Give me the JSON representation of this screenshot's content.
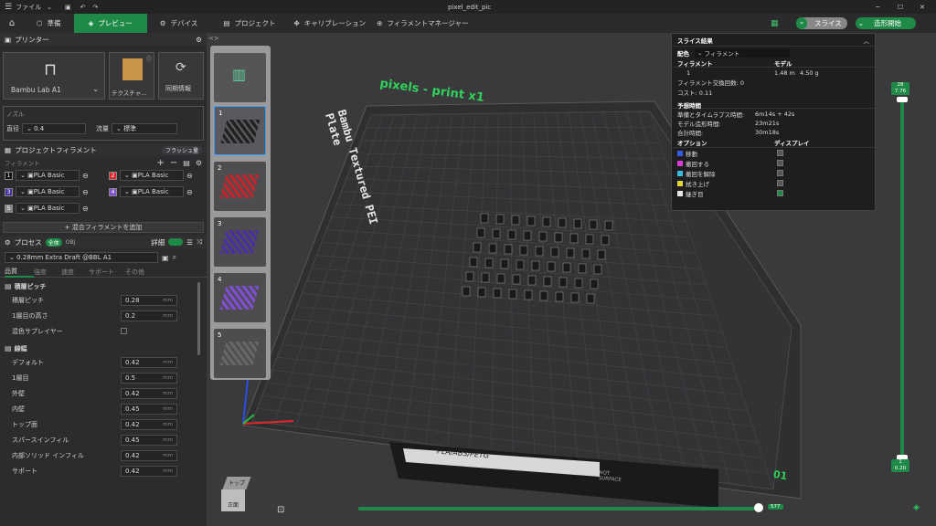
{
  "titlebar": {
    "menu": "ファイル",
    "title": "pixel_edit_pic"
  },
  "tabs": [
    {
      "label": "準備"
    },
    {
      "label": "プレビュー"
    },
    {
      "label": "デバイス"
    },
    {
      "label": "プロジェクト"
    },
    {
      "label": "キャリブレーション"
    },
    {
      "label": "フィラメントマネージャー"
    }
  ],
  "actions": {
    "slice": "スライス",
    "print": "造形開始"
  },
  "printer": {
    "header": "プリンター",
    "name": "Bambu Lab A1",
    "plate": "テクスチャ...",
    "sync": "同期情報",
    "nozzle_label": "ノズル",
    "diameter_label": "直径",
    "diameter": "0.4",
    "flow_label": "流量",
    "flow": "標準"
  },
  "filament": {
    "header": "プロジェクトフィラメント",
    "flush": "フラッシュ量",
    "sub": "フィラメント",
    "slots": [
      {
        "num": "1",
        "name": "PLA Basic",
        "color": "#111111"
      },
      {
        "num": "2",
        "name": "PLA Basic",
        "color": "#d8262b"
      },
      {
        "num": "3",
        "name": "PLA Basic",
        "color": "#4a2fa0"
      },
      {
        "num": "4",
        "name": "PLA Basic",
        "color": "#7d4fcf"
      },
      {
        "num": "5",
        "name": "PLA Basic",
        "color": "#888888"
      }
    ],
    "add": "混合フィラメントを追加"
  },
  "process": {
    "header": "プロセス",
    "all": "全体",
    "obj": "OBJ",
    "detail": "詳細",
    "profile": "0.28mm Extra Draft @BBL A1",
    "tabs": [
      "品質",
      "強度",
      "速度",
      "サポート",
      "その他"
    ],
    "layer_group": "積層ピッチ",
    "layer_rows": [
      {
        "label": "積層ピッチ",
        "value": "0.28",
        "unit": "mm"
      },
      {
        "label": "1層目の高さ",
        "value": "0.2",
        "unit": "mm"
      }
    ],
    "adaptive": "混色サプレイヤー",
    "width_group": "線幅",
    "width_rows": [
      {
        "label": "デフォルト",
        "value": "0.42",
        "unit": "mm"
      },
      {
        "label": "1層目",
        "value": "0.5",
        "unit": "mm"
      },
      {
        "label": "外壁",
        "value": "0.42",
        "unit": "mm"
      },
      {
        "label": "内壁",
        "value": "0.45",
        "unit": "mm"
      },
      {
        "label": "トップ面",
        "value": "0.42",
        "unit": "mm"
      },
      {
        "label": "スパースインフィル",
        "value": "0.45",
        "unit": "mm"
      },
      {
        "label": "内部ソリッド インフィル",
        "value": "0.42",
        "unit": "mm"
      },
      {
        "label": "サポート",
        "value": "0.42",
        "unit": "mm"
      }
    ]
  },
  "plate": {
    "label": "pixels - print x1",
    "brand": "Bambu Textured PEI Plate",
    "footer": "PLA/ABS/PETG",
    "hot": "HOT SURFACE",
    "number": "01"
  },
  "thumbs": [
    {
      "num": "1"
    },
    {
      "num": "2"
    },
    {
      "num": "3"
    },
    {
      "num": "4"
    },
    {
      "num": "5"
    }
  ],
  "stats": {
    "title": "スライス結果",
    "color_label": "配色",
    "color_mode": "フィラメント",
    "filament_h": "フィラメント",
    "model_h": "モデル",
    "row1_num": "1",
    "row1_len": "1.48 m",
    "row1_wt": "4.50 g",
    "changes": "フィラメント交換回数: 0",
    "cost": "コスト: 0.11",
    "time_h": "予想時間",
    "prep_label": "準備とタイムラプス時間:",
    "prep": "6m14s + 42s",
    "model_time_label": "モデル造形時間:",
    "model_time": "23m21s",
    "total_label": "合計時間:",
    "total": "30m18s",
    "option_h": "オプション",
    "display_h": "ディスプレイ",
    "options": [
      {
        "label": "移動",
        "color": "#3a5bd9"
      },
      {
        "label": "撤回する",
        "color": "#d93ad9"
      },
      {
        "label": "撤回を解除",
        "color": "#3ab8d9"
      },
      {
        "label": "拭き上げ",
        "color": "#e0d83a"
      },
      {
        "label": "継ぎ目",
        "color": "#e8e8e8"
      }
    ]
  },
  "slider": {
    "top_a": "28",
    "top_b": "7.76",
    "bottom_a": "1",
    "bottom_b": "0.20",
    "h_value": "577"
  },
  "cube": {
    "top": "トップ",
    "front": "正面"
  }
}
